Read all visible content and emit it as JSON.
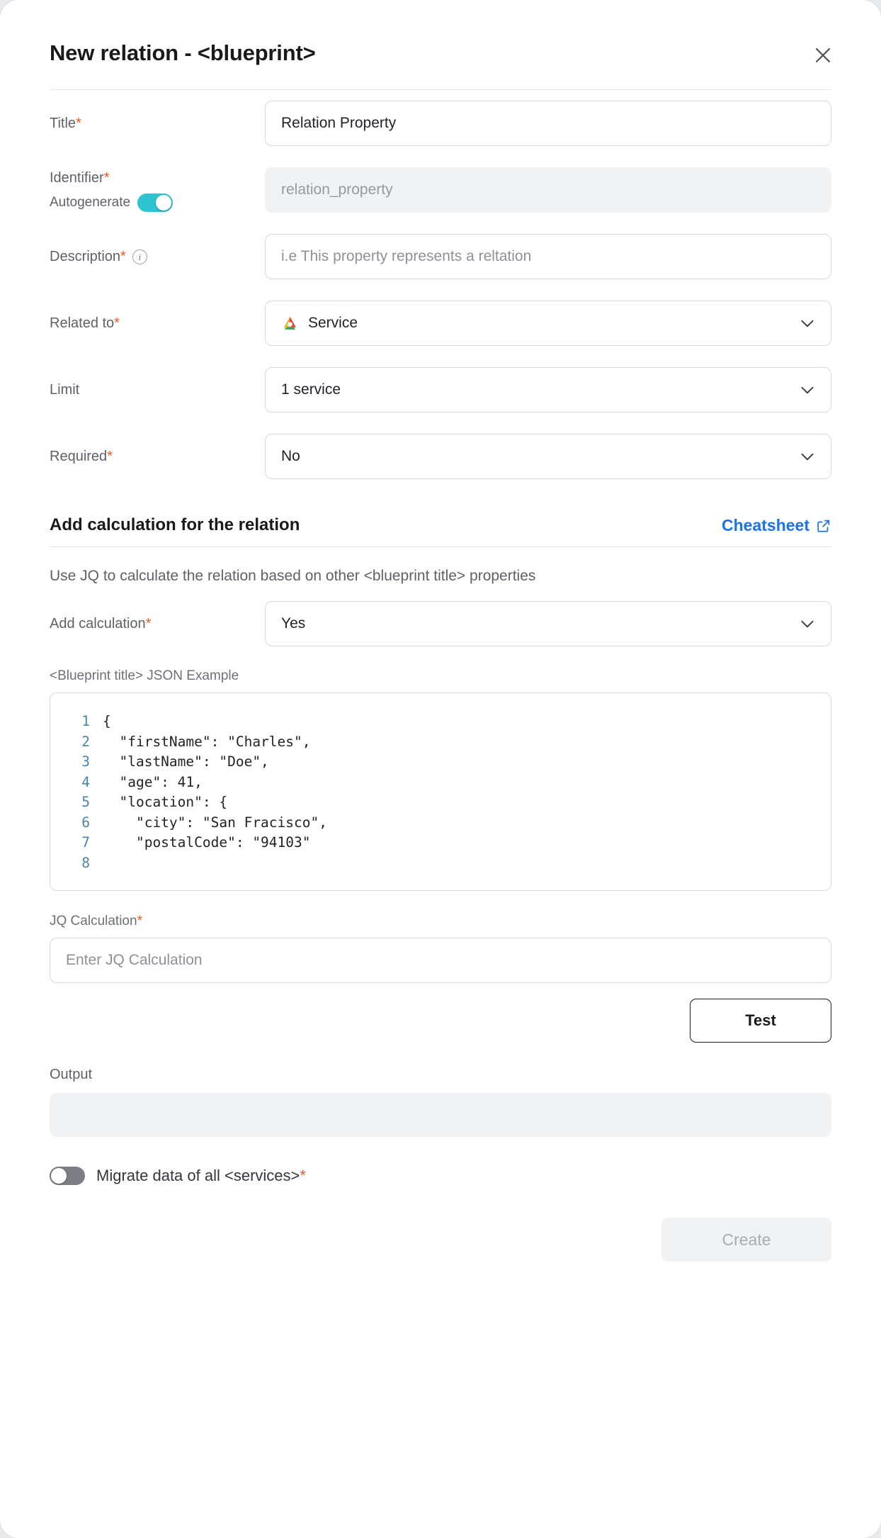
{
  "modal": {
    "title": "New relation - <blueprint>",
    "close_icon": "close-icon"
  },
  "form": {
    "title": {
      "label": "Title",
      "required": "*",
      "value": "Relation Property"
    },
    "identifier": {
      "label": "Identifier",
      "required": "*",
      "autogenerate_label": "Autogenerate",
      "autogenerate_on": true,
      "value": "relation_property"
    },
    "description": {
      "label": "Description",
      "required": "*",
      "placeholder": "i.e This property represents a reltation"
    },
    "related_to": {
      "label": "Related to",
      "required": "*",
      "value": "Service",
      "icon": "service-blueprint-icon"
    },
    "limit": {
      "label": "Limit",
      "value": "1 service"
    },
    "required_field": {
      "label": "Required",
      "required": "*",
      "value": "No"
    }
  },
  "calculation": {
    "section_title": "Add calculation for the relation",
    "cheatsheet_label": "Cheatsheet",
    "cheatsheet_icon": "external-link-icon",
    "note": "Use JQ to calculate the relation based on other <blueprint title> properties",
    "add_calculation": {
      "label": "Add calculation",
      "required": "*",
      "value": "Yes"
    },
    "json_example_label": "<Blueprint title> JSON Example",
    "json_example_lines": [
      {
        "n": "1",
        "code": "{"
      },
      {
        "n": "2",
        "code": "  \"firstName\": \"Charles\","
      },
      {
        "n": "3",
        "code": "  \"lastName\": \"Doe\","
      },
      {
        "n": "4",
        "code": "  \"age\": 41,"
      },
      {
        "n": "5",
        "code": "  \"location\": {"
      },
      {
        "n": "6",
        "code": "    \"city\": \"San Fracisco\","
      },
      {
        "n": "7",
        "code": "    \"postalCode\": \"94103\""
      },
      {
        "n": "8",
        "code": ""
      }
    ],
    "jq_calculation": {
      "label": "JQ Calculation",
      "required": "*",
      "placeholder": "Enter JQ Calculation"
    },
    "test_label": "Test",
    "output_label": "Output",
    "output_value": ""
  },
  "migrate": {
    "label": "Migrate data of all <services>",
    "required": "*",
    "enabled": false
  },
  "footer": {
    "create_label": "Create"
  },
  "colors": {
    "accent_link": "#1a73e8",
    "required_star": "#f4581f",
    "toggle_on": "#2ec5d3",
    "toggle_off": "#7b7f85"
  }
}
